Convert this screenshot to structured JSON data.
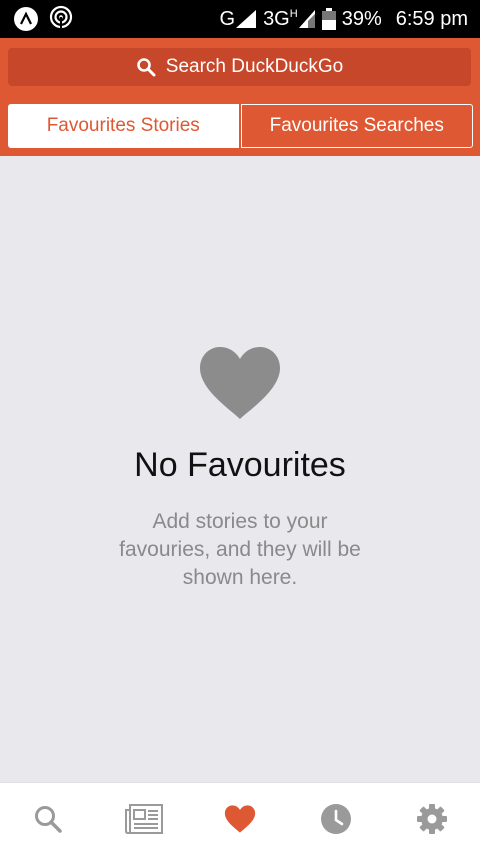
{
  "status_bar": {
    "network_g": "G",
    "network_3g": "3G",
    "network_h": "H",
    "battery": "39%",
    "time": "6:59 pm"
  },
  "search": {
    "placeholder": "Search DuckDuckGo"
  },
  "tabs": [
    {
      "label": "Favourites Stories",
      "active": true
    },
    {
      "label": "Favourites Searches",
      "active": false
    }
  ],
  "empty_state": {
    "title": "No Favourites",
    "description": "Add stories to your favouries, and they will be shown here."
  },
  "bottom_nav": {
    "items": [
      {
        "icon": "search-icon",
        "active": false
      },
      {
        "icon": "news-icon",
        "active": false
      },
      {
        "icon": "heart-icon",
        "active": true
      },
      {
        "icon": "clock-icon",
        "active": false
      },
      {
        "icon": "gear-icon",
        "active": false
      }
    ]
  },
  "colors": {
    "brand": "#de5833",
    "search_bar": "#c7472a",
    "background": "#e8e8ed",
    "icon_gray": "#9a9a9a",
    "heart_gray": "#8c8c8c"
  }
}
